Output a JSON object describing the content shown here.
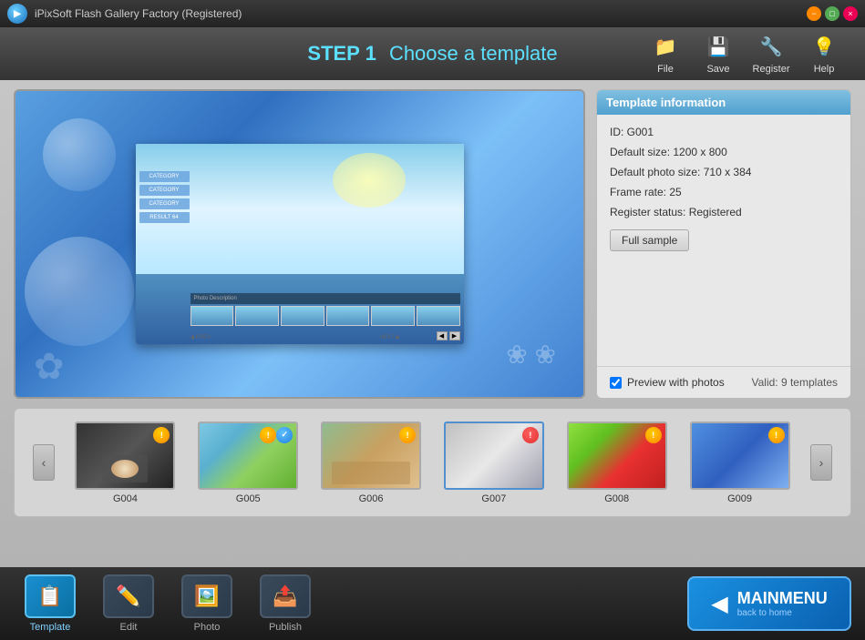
{
  "titlebar": {
    "title": "iPixSoft Flash Gallery Factory (Registered)",
    "controls": {
      "close": "×",
      "min": "−",
      "max": "□"
    }
  },
  "toolbar": {
    "step": "STEP 1",
    "subtitle": "Choose a template",
    "buttons": [
      {
        "id": "file",
        "label": "File",
        "icon": "📁"
      },
      {
        "id": "save",
        "label": "Save",
        "icon": "💾"
      },
      {
        "id": "register",
        "label": "Register",
        "icon": "🔧"
      },
      {
        "id": "help",
        "label": "Help",
        "icon": "💡"
      }
    ]
  },
  "info_panel": {
    "header": "Template information",
    "id": "ID: G001",
    "default_size": "Default size: 1200 x 800",
    "default_photo_size": "Default photo size: 710 x 384",
    "frame_rate": "Frame rate: 25",
    "register_status": "Register status: Registered",
    "full_sample_label": "Full sample",
    "preview_label": "Preview with photos",
    "valid_templates": "Valid: 9 templates"
  },
  "thumbnails": [
    {
      "id": "G004",
      "class": "thumb-g004",
      "selected": false,
      "badge_color": "gold"
    },
    {
      "id": "G005",
      "class": "thumb-g005",
      "selected": false,
      "badge_color": "blue"
    },
    {
      "id": "G006",
      "class": "thumb-g006",
      "selected": false,
      "badge_color": "gold"
    },
    {
      "id": "G007",
      "class": "thumb-g007",
      "selected": true,
      "badge_color": "gold"
    },
    {
      "id": "G008",
      "class": "thumb-g008",
      "selected": false,
      "badge_color": "gold"
    },
    {
      "id": "G009",
      "class": "thumb-g009",
      "selected": false,
      "badge_color": "gold"
    }
  ],
  "bottom_tabs": [
    {
      "id": "template",
      "label": "Template",
      "icon": "📋",
      "active": true
    },
    {
      "id": "edit",
      "label": "Edit",
      "icon": "✏️",
      "active": false
    },
    {
      "id": "photo",
      "label": "Photo",
      "icon": "🖼️",
      "active": false
    },
    {
      "id": "publish",
      "label": "Publish",
      "icon": "📤",
      "active": false
    }
  ],
  "mainmenu": {
    "label": "MAINMENU",
    "sublabel": "back to home"
  }
}
